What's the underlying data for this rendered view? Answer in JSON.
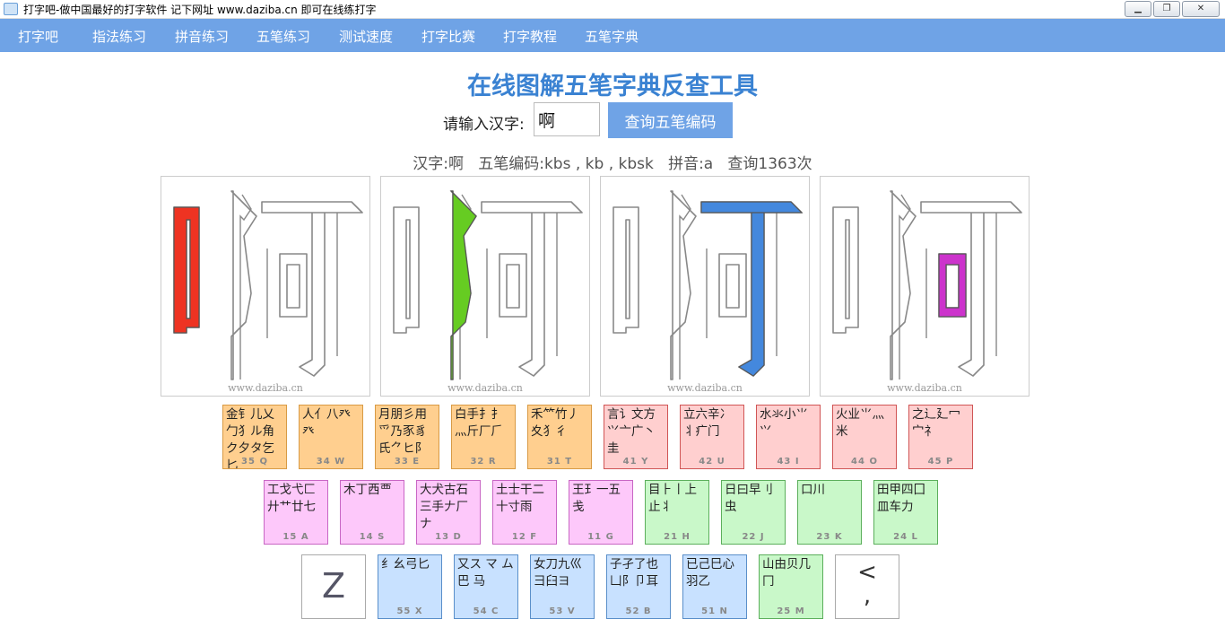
{
  "window": {
    "title": "打字吧-做中国最好的打字软件 记下网址 www.daziba.cn 即可在线练打字",
    "minimize_label": "▁",
    "maximize_label": "❐",
    "close_label": "✕"
  },
  "nav": [
    "打字吧",
    "指法练习",
    "拼音练习",
    "五笔练习",
    "测试速度",
    "打字比赛",
    "打字教程",
    "五笔字典"
  ],
  "page": {
    "title": "在线图解五笔字典反查工具",
    "input_label": "请输入汉字:",
    "input_value": "啊",
    "query_button": "查询五笔编码",
    "result": "汉字:啊   五笔编码:kbs , kb , kbsk   拼音:a   查询1363次"
  },
  "panels": {
    "character": "啊",
    "watermark": "www.daziba.cn",
    "highlight_colors": [
      "#ee3322",
      "#66cc22",
      "#4488dd",
      "#cc33cc"
    ]
  },
  "keyboard": {
    "row1": [
      {
        "glyphs": "金钅儿乂勹犭ル角ク夕タ乞匕",
        "code": "35 Q"
      },
      {
        "glyphs": "人亻八癶癶",
        "code": "34 W"
      },
      {
        "glyphs": "月朋彡用爫乃豕豸氏⺈ヒ⻖",
        "code": "33 E"
      },
      {
        "glyphs": "白手扌⺘⺣斤厂⺁",
        "code": "32 R"
      },
      {
        "glyphs": "禾⺮竹丿夊⺨彳",
        "code": "31 T"
      },
      {
        "glyphs": "言讠文方⺍亠广丶圭",
        "code": "41 Y"
      },
      {
        "glyphs": "立六辛冫丬疒门",
        "code": "42 U"
      },
      {
        "glyphs": "水氺小⺌⺍",
        "code": "43 I"
      },
      {
        "glyphs": "火业⺌灬米",
        "code": "44 O"
      },
      {
        "glyphs": "之辶廴冖宀礻",
        "code": "45 P"
      }
    ],
    "row2": [
      {
        "glyphs": "工戈弋匚廾艹廿七",
        "code": "15 A"
      },
      {
        "glyphs": "木丁西覀",
        "code": "14 S"
      },
      {
        "glyphs": "大犬古石三手𠂇厂ナ",
        "code": "13 D"
      },
      {
        "glyphs": "土士干二十寸雨",
        "code": "12 F"
      },
      {
        "glyphs": "王⺩一五戋",
        "code": "11 G"
      },
      {
        "glyphs": "目⺊丨上止⺦",
        "code": "21 H"
      },
      {
        "glyphs": "日曰早刂虫",
        "code": "22 J"
      },
      {
        "glyphs": "口川",
        "code": "23 K"
      },
      {
        "glyphs": "田甲四囗皿车力",
        "code": "24 L"
      }
    ],
    "row3": [
      {
        "glyphs": "Z",
        "code": ""
      },
      {
        "glyphs": "纟幺弓匕",
        "code": "55 X"
      },
      {
        "glyphs": "又ス マ ム巴 马",
        "code": "54 C"
      },
      {
        "glyphs": "女刀九巛彐臼ヨ",
        "code": "53 V"
      },
      {
        "glyphs": "子孑了也凵阝卩耳",
        "code": "52 B"
      },
      {
        "glyphs": "已己巳心羽乙",
        "code": "51 N"
      },
      {
        "glyphs": "山由贝几冂",
        "code": "25 M"
      },
      {
        "glyphs": "<\n,",
        "code": ""
      }
    ]
  }
}
